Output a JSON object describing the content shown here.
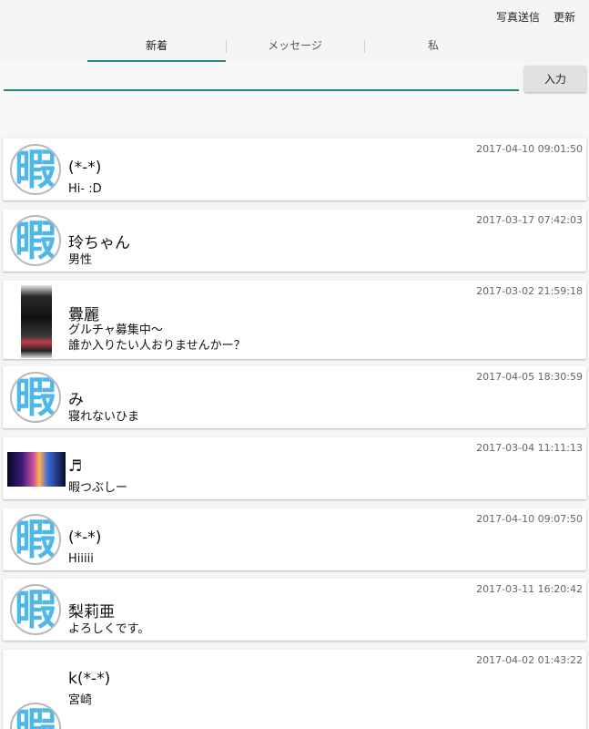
{
  "top_actions": {
    "send_photo": "写真送信",
    "refresh": "更新"
  },
  "tabs": [
    {
      "label": "新着",
      "active": true
    },
    {
      "label": "メッセージ",
      "active": false
    },
    {
      "label": "私",
      "active": false
    }
  ],
  "composer": {
    "value": "",
    "placeholder": "",
    "submit_label": "入力"
  },
  "colors": {
    "accent": "#1d8a7a",
    "avatar_glyph": "#4fb8e8"
  },
  "posts": [
    {
      "name": "(*-*)",
      "message": "Hi- :D",
      "time": "2017-04-10 09:01:50",
      "avatar": "default-avatar",
      "avatar_glyph": "暇"
    },
    {
      "name": "玲ちゃん",
      "message": "男性",
      "time": "2017-03-17 07:42:03",
      "avatar": "default-avatar",
      "avatar_glyph": "暇"
    },
    {
      "name": "釁麗",
      "message": "グルチャ募集中〜\n誰か入りたい人おりませんかー？",
      "time": "2017-03-02 21:59:18",
      "avatar": "user-photo"
    },
    {
      "name": "み",
      "message": "寝れないひま",
      "time": "2017-04-05 18:30:59",
      "avatar": "default-avatar",
      "avatar_glyph": "暇"
    },
    {
      "name": "♬",
      "message": "暇つぶしー",
      "time": "2017-03-04 11:11:13",
      "avatar": "user-photo"
    },
    {
      "name": "(*-*)",
      "message": "Hiiiii",
      "time": "2017-04-10 09:07:50",
      "avatar": "default-avatar",
      "avatar_glyph": "暇"
    },
    {
      "name": "梨莉亜",
      "message": "よろしくです。",
      "time": "2017-03-11 16:20:42",
      "avatar": "default-avatar",
      "avatar_glyph": "暇"
    },
    {
      "name": "k(*-*)",
      "message": "宮崎",
      "time": "2017-04-02 01:43:22",
      "avatar": "default-avatar",
      "avatar_glyph": "暇"
    }
  ]
}
